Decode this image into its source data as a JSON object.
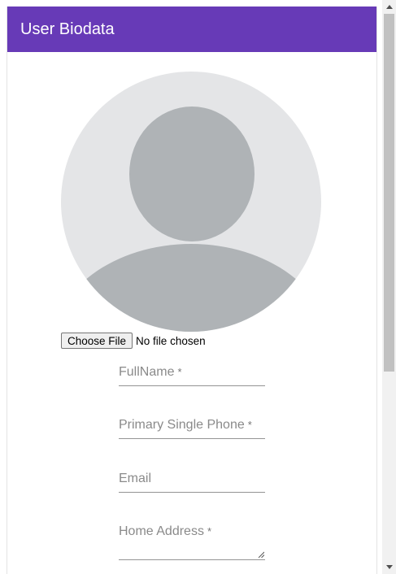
{
  "header": {
    "title": "User Biodata"
  },
  "avatar": {
    "icon": "user-avatar-placeholder-icon",
    "bg_color": "#e4e5e7",
    "figure_color": "#afb3b6"
  },
  "file_input": {
    "button_label": "Choose File",
    "status_text": "No file chosen"
  },
  "form": {
    "fullname": {
      "label": "FullName",
      "required_mark": "*"
    },
    "phone": {
      "label": "Primary Single Phone",
      "required_mark": "*"
    },
    "email": {
      "label": "Email"
    },
    "address": {
      "label": "Home Address",
      "required_mark": "*"
    }
  },
  "colors": {
    "header_bg": "#673ab7",
    "header_text": "#ffffff"
  }
}
